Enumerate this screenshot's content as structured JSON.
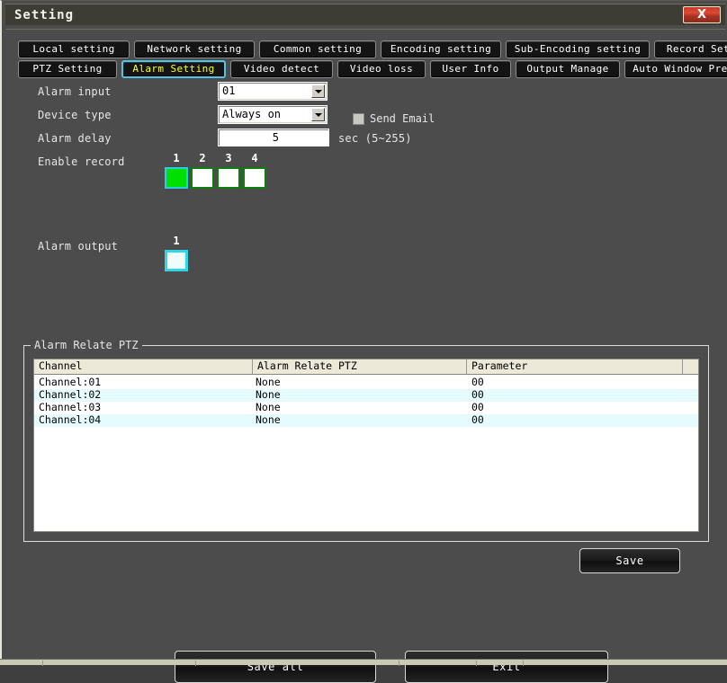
{
  "window": {
    "title": "Setting",
    "close_label": "X",
    "accent_active_tab_border": "#4fc3e8",
    "accent_active_tab_text": "#ffff33",
    "close_button_color": "#c0392b"
  },
  "tabs": {
    "row1": [
      {
        "label": "Local setting",
        "active": false
      },
      {
        "label": "Network setting",
        "active": false
      },
      {
        "label": "Common setting",
        "active": false
      },
      {
        "label": "Encoding setting",
        "active": false
      },
      {
        "label": "Sub-Encoding setting",
        "active": false
      },
      {
        "label": "Record Setting",
        "active": false
      }
    ],
    "row2": [
      {
        "label": "PTZ Setting",
        "active": false
      },
      {
        "label": "Alarm Setting",
        "active": true
      },
      {
        "label": "Video detect",
        "active": false
      },
      {
        "label": "Video loss",
        "active": false
      },
      {
        "label": "User Info",
        "active": false
      },
      {
        "label": "Output Manage",
        "active": false
      },
      {
        "label": "Auto Window Preview",
        "active": false
      }
    ]
  },
  "form": {
    "alarm_input_label": "Alarm input",
    "alarm_input_value": "01",
    "device_type_label": "Device type",
    "device_type_value": "Always on",
    "alarm_delay_label": "Alarm delay",
    "alarm_delay_value": "5",
    "alarm_delay_unit": "sec (5~255)",
    "send_email_label": "Send Email",
    "send_email_checked": false,
    "enable_record_label": "Enable record",
    "enable_record_channels": [
      {
        "num": "1",
        "checked": true
      },
      {
        "num": "2",
        "checked": false
      },
      {
        "num": "3",
        "checked": false
      },
      {
        "num": "4",
        "checked": false
      }
    ],
    "alarm_output_label": "Alarm output",
    "alarm_output_channels": [
      {
        "num": "1",
        "checked": true
      }
    ]
  },
  "ptz_group": {
    "legend": "Alarm Relate PTZ",
    "columns": [
      "Channel",
      "Alarm Relate PTZ",
      "Parameter",
      ""
    ],
    "rows": [
      {
        "channel": "Channel:01",
        "relate": "None",
        "parameter": "00"
      },
      {
        "channel": "Channel:02",
        "relate": "None",
        "parameter": "00"
      },
      {
        "channel": "Channel:03",
        "relate": "None",
        "parameter": "00"
      },
      {
        "channel": "Channel:04",
        "relate": "None",
        "parameter": "00"
      }
    ]
  },
  "buttons": {
    "save": "Save",
    "save_all": "Save all",
    "exit": "Exit"
  }
}
